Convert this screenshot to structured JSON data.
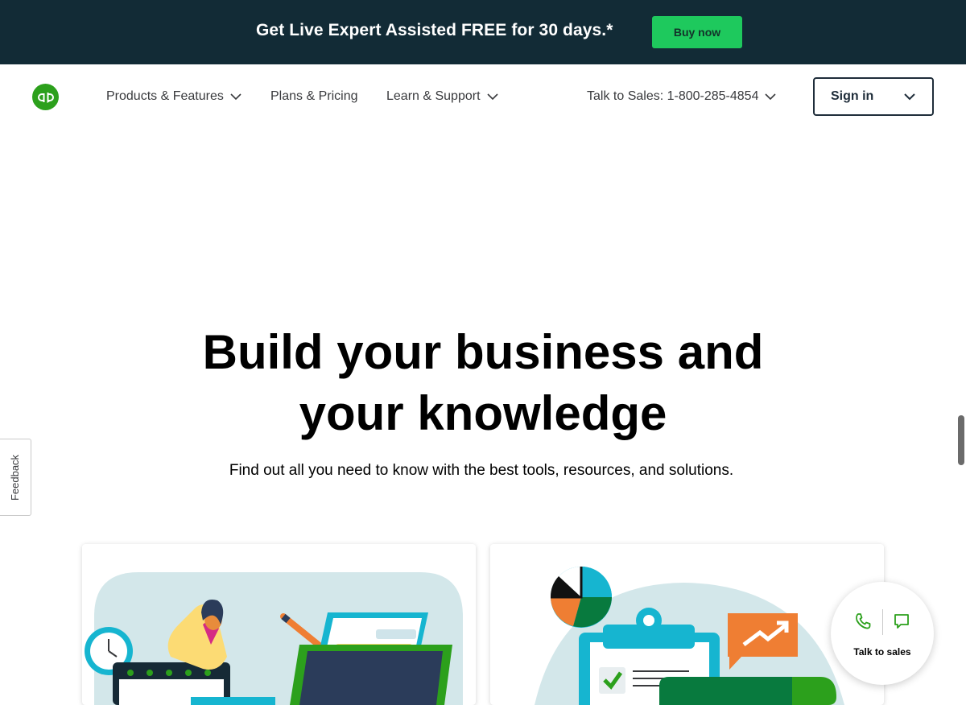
{
  "promo": {
    "text": "Get Live Expert Assisted FREE for 30 days.*",
    "button_label": "Buy now"
  },
  "header": {
    "logo": "quickbooks-logo",
    "nav": [
      {
        "label": "Products & Features",
        "has_dropdown": true
      },
      {
        "label": "Plans & Pricing",
        "has_dropdown": false
      },
      {
        "label": "Learn & Support",
        "has_dropdown": true
      }
    ],
    "sales": {
      "label": "Talk to Sales: 1-800-285-4854",
      "has_dropdown": true
    },
    "signin_label": "Sign in"
  },
  "hero": {
    "title_line1": "Build your business and",
    "title_line2": "your knowledge",
    "subtitle": "Find out all you need to know with the best tools, resources, and solutions."
  },
  "feedback_tab": "Feedback",
  "chat_widget": {
    "label": "Talk to sales",
    "icons": [
      "phone-icon",
      "chat-bubble-icon"
    ]
  },
  "colors": {
    "promo_bg": "#122b36",
    "brand_green": "#2ca01c",
    "button_green": "#1ec95d",
    "nav_text": "#393a3d"
  }
}
